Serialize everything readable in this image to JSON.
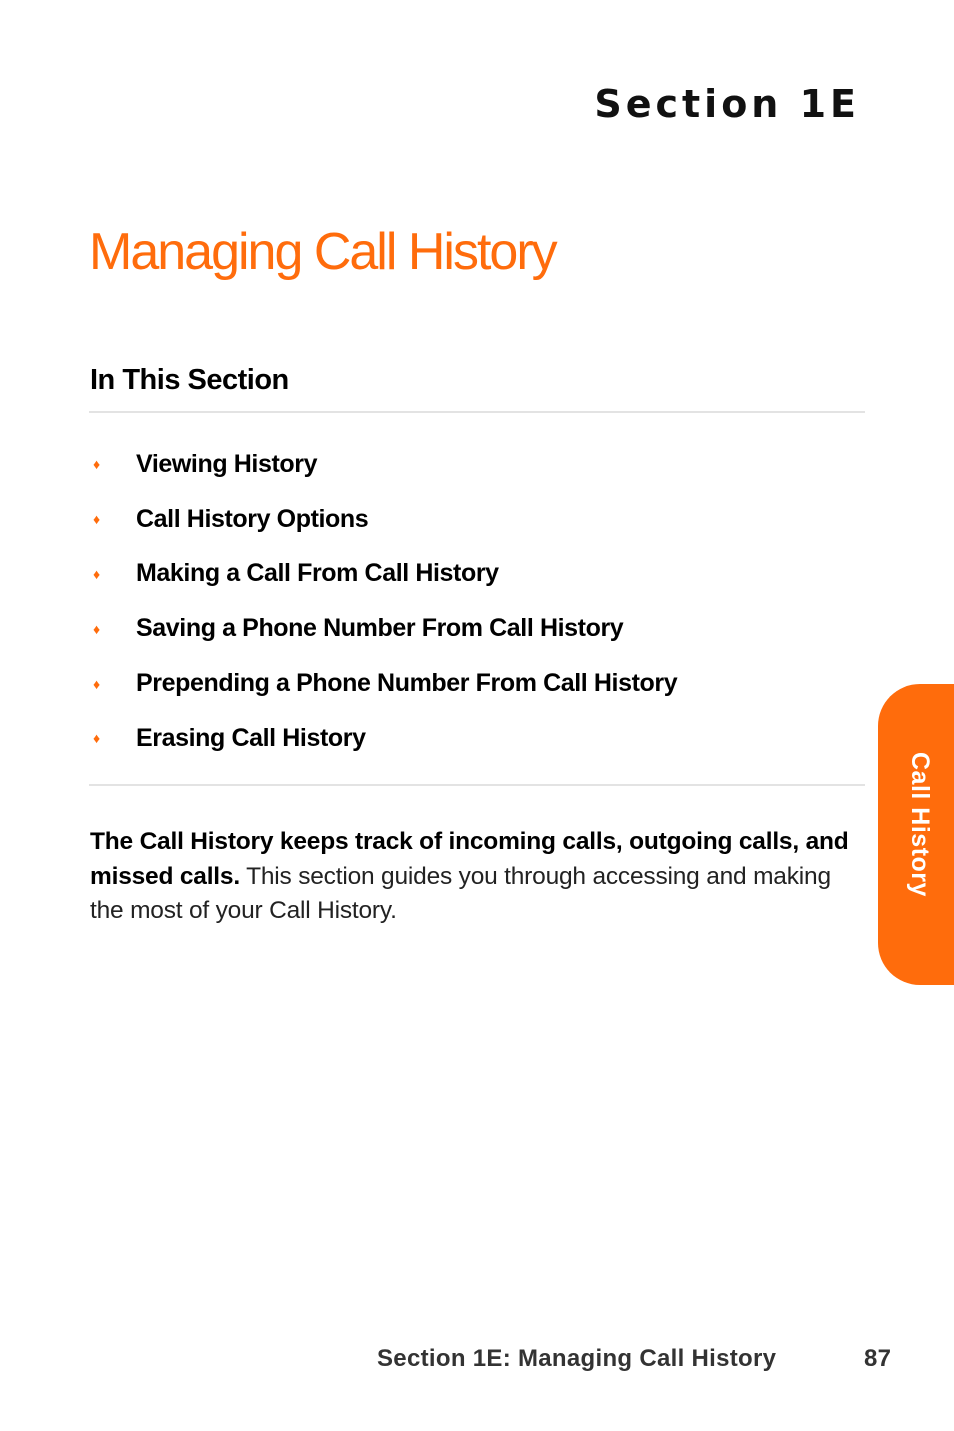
{
  "header": {
    "section_label": "Section 1E",
    "title": "Managing Call History"
  },
  "in_this_section": {
    "heading": "In This Section",
    "bullet_icon": "orange-diamond",
    "items": [
      {
        "label": "Viewing History"
      },
      {
        "label": "Call History Options"
      },
      {
        "label": "Making a Call From Call History"
      },
      {
        "label": "Saving a Phone Number From Call History"
      },
      {
        "label": "Prepending a Phone Number From Call History"
      },
      {
        "label": "Erasing Call History"
      }
    ]
  },
  "intro": {
    "bold": "The Call History keeps track of incoming calls, outgoing calls, and missed calls.",
    "text": " This section guides you through accessing and making the most of your Call History."
  },
  "side_tab": {
    "label": "Call History",
    "color": "#ff6c0c"
  },
  "footer": {
    "title": "Section 1E: Managing Call History",
    "page_number": "87"
  },
  "colors": {
    "accent": "#ff6c0c"
  }
}
